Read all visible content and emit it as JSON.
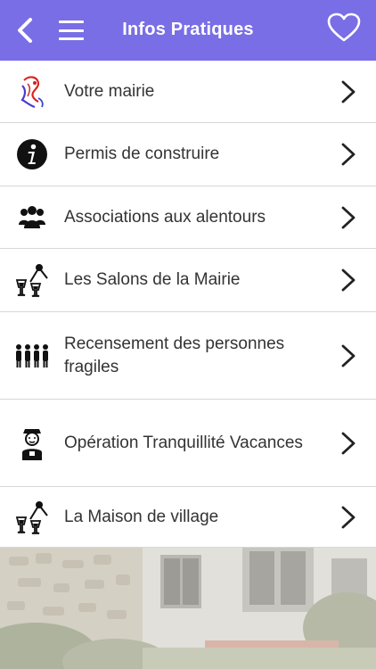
{
  "header": {
    "title": "Infos Pratiques",
    "back_icon": "chevron-left-icon",
    "menu_icon": "hamburger-menu-icon",
    "favorite_icon": "heart-outline-icon",
    "background_color": "#7a6ee6"
  },
  "list": {
    "items": [
      {
        "label": "Votre mairie",
        "icon": "marianne-icon"
      },
      {
        "label": "Permis de construire",
        "icon": "info-icon"
      },
      {
        "label": "Associations aux alentours",
        "icon": "group-icon"
      },
      {
        "label": "Les Salons de la Mairie",
        "icon": "microphone-glasses-icon"
      },
      {
        "label": "Recensement des personnes fragiles",
        "icon": "people-line-icon"
      },
      {
        "label": "Opération Tranquillité Vacances",
        "icon": "police-officer-icon"
      },
      {
        "label": "La Maison de village",
        "icon": "microphone-glasses-icon"
      }
    ],
    "chevron_icon": "chevron-right-icon"
  },
  "background": {
    "image": "house-garden-photo"
  }
}
